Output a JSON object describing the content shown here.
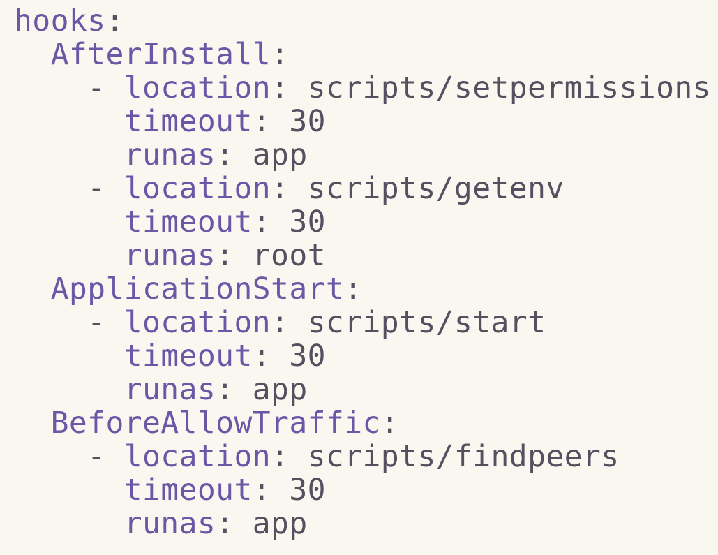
{
  "root_key": "hooks",
  "hooks": [
    {
      "name": "AfterInstall",
      "entries": [
        {
          "location": "scripts/setpermissions",
          "timeout": "30",
          "runas": "app"
        },
        {
          "location": "scripts/getenv",
          "timeout": "30",
          "runas": "root"
        }
      ]
    },
    {
      "name": "ApplicationStart",
      "entries": [
        {
          "location": "scripts/start",
          "timeout": "30",
          "runas": "app"
        }
      ]
    },
    {
      "name": "BeforeAllowTraffic",
      "entries": [
        {
          "location": "scripts/findpeers",
          "timeout": "30",
          "runas": "app"
        }
      ]
    }
  ],
  "labels": {
    "location": "location",
    "timeout": "timeout",
    "runas": "runas"
  },
  "colors": {
    "background": "#faf7f0",
    "key": "#6c57a6",
    "value": "#564f60"
  }
}
